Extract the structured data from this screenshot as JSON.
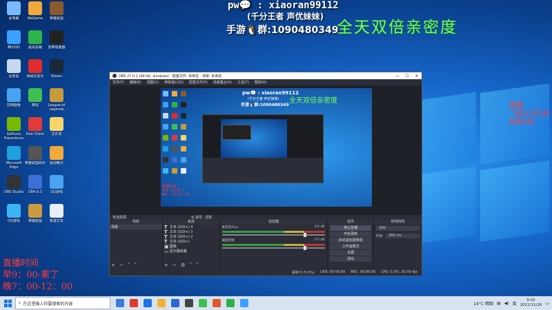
{
  "overlay": {
    "pw_line": "pw💬 : xiaoran99112",
    "sub_line": "(千分王者 声优妹妹)",
    "qq_line": "手游🐧群:1090480349",
    "banner": "全天双倍亲密度",
    "right_note": [
      "直播",
      "飞机上号2动",
      "钻粉4钻"
    ],
    "schedule": [
      "直播时间",
      "早9：00-累了",
      "晚7：00-12：00"
    ]
  },
  "desktop_icons": [
    {
      "label": "此电脑",
      "color": "#7ab8ff"
    },
    {
      "label": "腾讯QQ",
      "color": "#3aa0ff"
    },
    {
      "label": "回收站",
      "color": "#c7d9ef"
    },
    {
      "label": "控制面板",
      "color": "#4aa3f0"
    },
    {
      "label": "GeForce Experience",
      "color": "#76b900"
    },
    {
      "label": "Microsoft Edge",
      "color": "#1fa0e0"
    },
    {
      "label": "OBS Studio",
      "color": "#333"
    },
    {
      "label": "QQ游戏",
      "color": "#3cb5f5"
    },
    {
      "label": "WeGame",
      "color": "#f2a93b"
    },
    {
      "label": "驱动总裁",
      "color": "#2db34a"
    },
    {
      "label": "网易云音乐",
      "color": "#e02c2c"
    },
    {
      "label": "微信",
      "color": "#3fbf52"
    },
    {
      "label": "Riot Client",
      "color": "#e23a3a"
    },
    {
      "label": "英雄联盟助手",
      "color": "#555"
    },
    {
      "label": "DB4.9.3",
      "color": "#3d6fd6"
    },
    {
      "label": "英雄联盟",
      "color": "#c89b3c"
    },
    {
      "label": "英雄联盟",
      "color": "#8b5a2b"
    },
    {
      "label": "雷神加速器",
      "color": "#222"
    },
    {
      "label": "Steam",
      "color": "#1b2838"
    },
    {
      "label": "League of Legends",
      "color": "#c89b3c"
    },
    {
      "label": "文件夹",
      "color": "#f7d46a"
    },
    {
      "label": "驱动精灵",
      "color": "#f2a93b"
    },
    {
      "label": "QQ游戏",
      "color": "#4aa3f0"
    },
    {
      "label": "新建文本",
      "color": "#e8eef7"
    }
  ],
  "obs": {
    "title": "OBS 27.0.1 (64-bit, windows) - 配置文件: 未命名 - 场景: 未命名",
    "menu": [
      "文件(F)",
      "编辑(E)",
      "视图(V)",
      "停靠窗口(D)",
      "配置文件(P)",
      "场景集合(S)",
      "工具(T)",
      "帮助(H)"
    ],
    "preview_texts": {
      "pw": "pw💬 : xiaoran99112",
      "sub": "(千分王者 声优妹妹)",
      "qq": "手游🐧群:1090480349",
      "big": "全天双倍亲密度",
      "sched": [
        "直播时间",
        "早9：00-累了",
        "晚7：00-12：00"
      ]
    },
    "status_strip": [
      "未选择源",
      "⚙ 属性",
      "滤镜"
    ],
    "docks": {
      "scenes": {
        "header": "场景",
        "items": [
          "场景"
        ]
      },
      "sources": {
        "header": "来源",
        "items": [
          "文本 (GDI+) 4",
          "文本 (GDI+) 3",
          "文本 (GDI+) 2",
          "文本 (GDI+)",
          "图像",
          "显示器采集"
        ]
      },
      "mixer": {
        "header": "混音器",
        "rows": [
          {
            "name": "麦克风/Aux",
            "db": "0.0 dB"
          },
          {
            "name": "桌面音频",
            "db": "0.0 dB"
          }
        ]
      },
      "controls": {
        "header": "控件",
        "buttons": [
          "停止直播",
          "开始录制",
          "启动虚拟摄像机",
          "工作室模式",
          "设置",
          "退出"
        ]
      },
      "transitions": {
        "header": "转场特效",
        "type": "淡出",
        "duration_label": "时长",
        "duration": "300 ms"
      }
    },
    "status_bar": [
      "丢帧 0 (0.0%)",
      "LIVE: 00:00:00",
      "REC: 00:00:00",
      "CPU: 0.5%, 30.00 fps"
    ]
  },
  "taskbar": {
    "search_placeholder": "在这里输入你要搜索的内容",
    "apps": [
      "#3d7be0",
      "#e03a2a",
      "#1a73e8",
      "#f2b233",
      "#2a66d6",
      "#444",
      "#3fbf52",
      "#e05a2c",
      "#2db34a",
      "#3aa0ff"
    ],
    "weather": "14°C 晴朗",
    "time": "9:02",
    "date": "2022/11/26"
  }
}
